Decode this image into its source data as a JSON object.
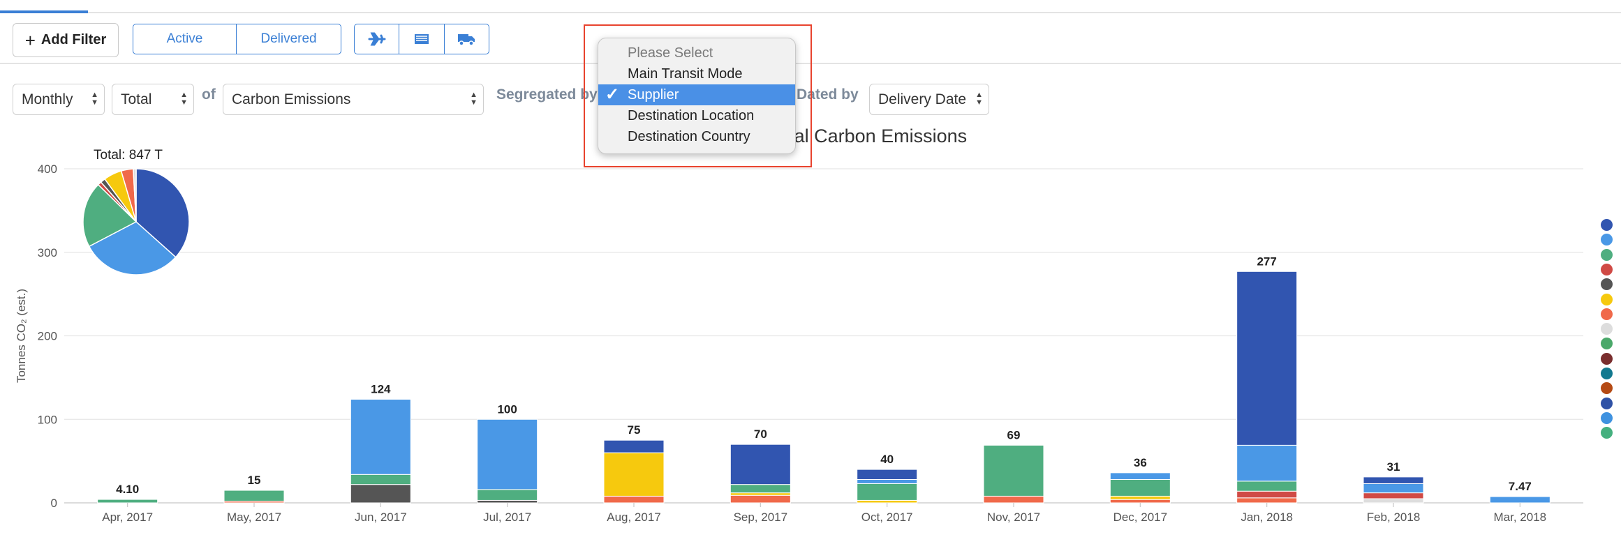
{
  "toolbar": {
    "add_filter_label": "Add Filter",
    "status_tabs": [
      "Active",
      "Delivered"
    ],
    "mode_icons": [
      "plane-icon",
      "ship-icon",
      "truck-icon"
    ]
  },
  "controls": {
    "period": "Monthly",
    "aggregate": "Total",
    "of_label": "of",
    "metric": "Carbon Emissions",
    "segregated_label": "Segregated by",
    "dated_label": "Dated by",
    "date_field": "Delivery Date"
  },
  "dropdown": {
    "options": [
      "Please Select",
      "Main Transit Mode",
      "Supplier",
      "Destination Location",
      "Destination Country"
    ],
    "selected": "Supplier"
  },
  "colors": {
    "accent": "#3a7fd5",
    "highlight": "#e8432e",
    "series": [
      "#3155b0",
      "#4a98e6",
      "#4fae80",
      "#d04a45",
      "#555555",
      "#f6c90e",
      "#f0694a",
      "#dddddd",
      "#4aa86a",
      "#7a2e2e",
      "#12798f",
      "#b54a14",
      "#2f52a6",
      "#3f92e0",
      "#45b07f"
    ]
  },
  "chart_data": {
    "type": "bar",
    "title": "Monthly Total Carbon Emissions",
    "ylabel": "Tonnes CO₂ (est.)",
    "xlabel": "",
    "ylim": [
      0,
      400
    ],
    "yticks": [
      0,
      100,
      200,
      300,
      400
    ],
    "categories": [
      "Apr, 2017",
      "May, 2017",
      "Jun, 2017",
      "Jul, 2017",
      "Aug, 2017",
      "Sep, 2017",
      "Oct, 2017",
      "Nov, 2017",
      "Dec, 2017",
      "Jan, 2018",
      "Feb, 2018",
      "Mar, 2018"
    ],
    "totals": [
      "4.10",
      "15",
      "124",
      "100",
      "75",
      "70",
      "40",
      "69",
      "36",
      "277",
      "31",
      "7.47"
    ],
    "stacks": [
      [
        {
          "color": "#4fae80",
          "value": 4.1
        }
      ],
      [
        {
          "color": "#f0694a",
          "value": 2
        },
        {
          "color": "#4fae80",
          "value": 13
        }
      ],
      [
        {
          "color": "#555555",
          "value": 22
        },
        {
          "color": "#4fae80",
          "value": 12
        },
        {
          "color": "#4a98e6",
          "value": 90
        }
      ],
      [
        {
          "color": "#555555",
          "value": 3
        },
        {
          "color": "#4fae80",
          "value": 13
        },
        {
          "color": "#4a98e6",
          "value": 84
        }
      ],
      [
        {
          "color": "#f0694a",
          "value": 8
        },
        {
          "color": "#f6c90e",
          "value": 52
        },
        {
          "color": "#3155b0",
          "value": 15
        }
      ],
      [
        {
          "color": "#f0694a",
          "value": 9
        },
        {
          "color": "#f6c90e",
          "value": 3
        },
        {
          "color": "#4fae80",
          "value": 10
        },
        {
          "color": "#3155b0",
          "value": 48
        }
      ],
      [
        {
          "color": "#f6c90e",
          "value": 3
        },
        {
          "color": "#4fae80",
          "value": 20
        },
        {
          "color": "#4a98e6",
          "value": 5
        },
        {
          "color": "#3155b0",
          "value": 12
        }
      ],
      [
        {
          "color": "#f0694a",
          "value": 8
        },
        {
          "color": "#4fae80",
          "value": 61
        }
      ],
      [
        {
          "color": "#f0694a",
          "value": 4
        },
        {
          "color": "#f6c90e",
          "value": 4
        },
        {
          "color": "#4fae80",
          "value": 20
        },
        {
          "color": "#4a98e6",
          "value": 8
        }
      ],
      [
        {
          "color": "#f0694a",
          "value": 6
        },
        {
          "color": "#d04a45",
          "value": 8
        },
        {
          "color": "#4fae80",
          "value": 12
        },
        {
          "color": "#4a98e6",
          "value": 43
        },
        {
          "color": "#3155b0",
          "value": 208
        }
      ],
      [
        {
          "color": "#dddddd",
          "value": 5
        },
        {
          "color": "#d04a45",
          "value": 7
        },
        {
          "color": "#4a98e6",
          "value": 11
        },
        {
          "color": "#3155b0",
          "value": 8
        }
      ],
      [
        {
          "color": "#4a98e6",
          "value": 7.47
        }
      ]
    ],
    "pie": {
      "total_label": "Total: 847 T",
      "slices": [
        {
          "color": "#3155b0",
          "value": 298
        },
        {
          "color": "#4a98e6",
          "value": 250
        },
        {
          "color": "#4fae80",
          "value": 163
        },
        {
          "color": "#d04a45",
          "value": 9
        },
        {
          "color": "#555555",
          "value": 12
        },
        {
          "color": "#f6c90e",
          "value": 45
        },
        {
          "color": "#f0694a",
          "value": 30
        },
        {
          "color": "#dddddd",
          "value": 7
        }
      ]
    },
    "legend_colors": [
      "#3155b0",
      "#4a98e6",
      "#4fae80",
      "#d04a45",
      "#555555",
      "#f6c90e",
      "#f0694a",
      "#dddddd",
      "#4aa86a",
      "#7a2e2e",
      "#12798f",
      "#b54a14",
      "#2f52a6",
      "#3f92e0",
      "#45b07f"
    ]
  }
}
